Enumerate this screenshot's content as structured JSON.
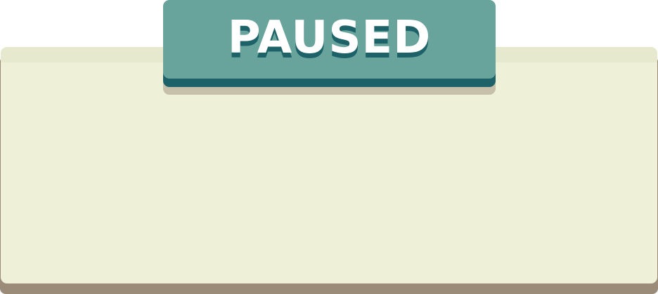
{
  "pause_screen": {
    "title": "PAUSED"
  },
  "colors": {
    "banner": "#68a49c",
    "banner_edge": "#1e6269",
    "panel": "#eef0d8",
    "panel_edge": "#9b8b79"
  }
}
